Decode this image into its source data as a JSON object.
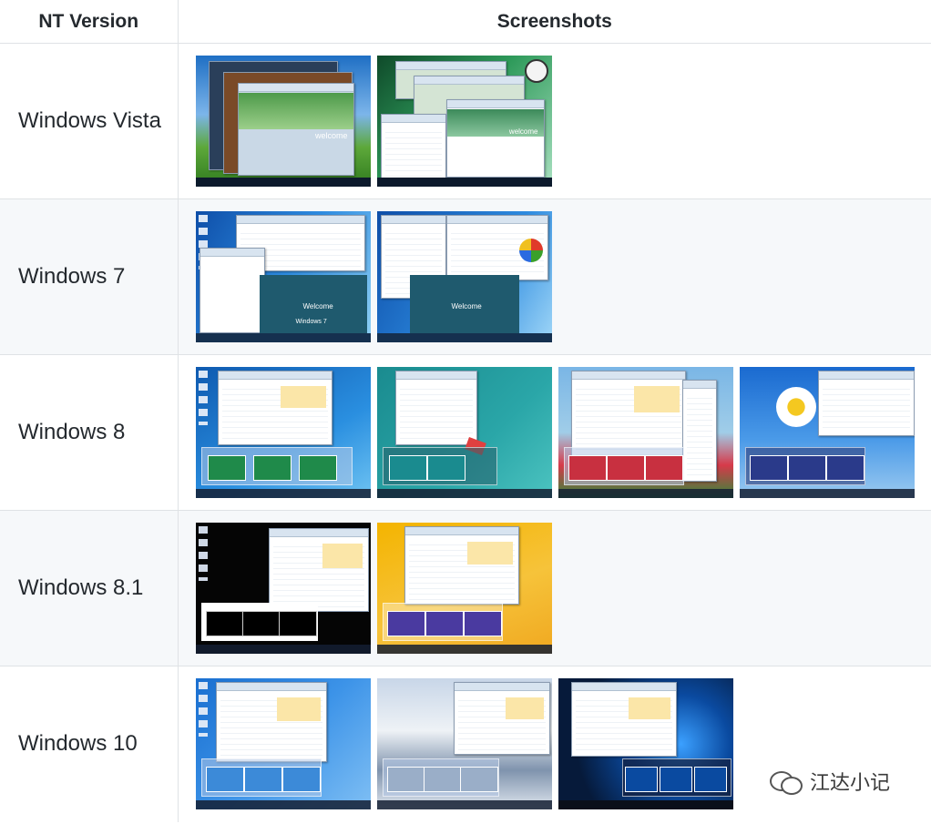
{
  "table": {
    "headers": [
      "NT Version",
      "Screenshots"
    ],
    "rows": [
      {
        "version": "Windows Vista"
      },
      {
        "version": "Windows 7"
      },
      {
        "version": "Windows 8"
      },
      {
        "version": "Windows 8.1"
      },
      {
        "version": "Windows 10"
      }
    ]
  },
  "screenshot_text": {
    "vista_welcome": "welcome",
    "win7_welcome": "Welcome",
    "win7_brand": "Windows 7"
  },
  "watermark": {
    "text": "江达小记",
    "icon": "wechat-icon"
  },
  "colors": {
    "border": "#dfe2e5",
    "alt_row": "#f6f8fa",
    "text": "#24292e"
  }
}
